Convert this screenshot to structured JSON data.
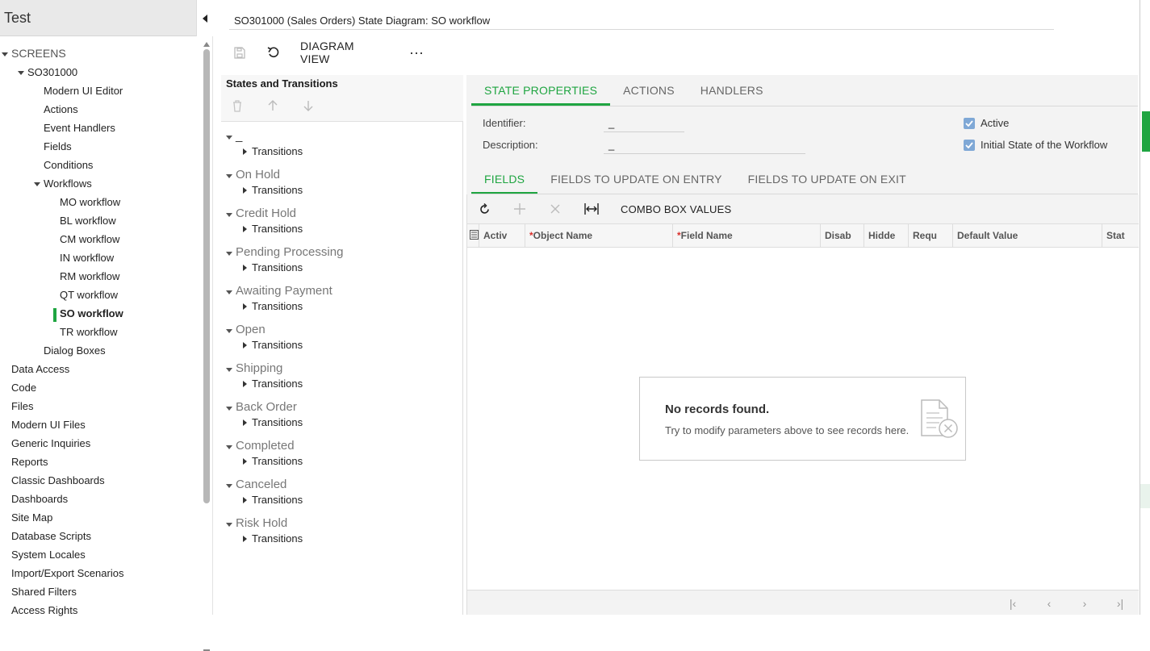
{
  "nav": {
    "title": "Test",
    "tree": [
      {
        "label": "SCREENS",
        "level": 0,
        "expanded": true
      },
      {
        "label": "SO301000",
        "level": 1,
        "expanded": true
      },
      {
        "label": "Modern UI Editor",
        "level": 2
      },
      {
        "label": "Actions",
        "level": 2
      },
      {
        "label": "Event Handlers",
        "level": 2
      },
      {
        "label": "Fields",
        "level": 2
      },
      {
        "label": "Conditions",
        "level": 2
      },
      {
        "label": "Workflows",
        "level": 2,
        "expanded": true
      },
      {
        "label": "MO workflow",
        "level": 3
      },
      {
        "label": "BL workflow",
        "level": 3
      },
      {
        "label": "CM workflow",
        "level": 3
      },
      {
        "label": "IN workflow",
        "level": 3
      },
      {
        "label": "RM workflow",
        "level": 3
      },
      {
        "label": "QT workflow",
        "level": 3
      },
      {
        "label": "SO workflow",
        "level": 3,
        "selected": true
      },
      {
        "label": "TR workflow",
        "level": 3
      },
      {
        "label": "Dialog Boxes",
        "level": 2
      },
      {
        "label": "Data Access",
        "level": 0
      },
      {
        "label": "Code",
        "level": 0
      },
      {
        "label": "Files",
        "level": 0
      },
      {
        "label": "Modern UI Files",
        "level": 0
      },
      {
        "label": "Generic Inquiries",
        "level": 0
      },
      {
        "label": "Reports",
        "level": 0
      },
      {
        "label": "Classic Dashboards",
        "level": 0
      },
      {
        "label": "Dashboards",
        "level": 0
      },
      {
        "label": "Site Map",
        "level": 0
      },
      {
        "label": "Database Scripts",
        "level": 0
      },
      {
        "label": "System Locales",
        "level": 0
      },
      {
        "label": "Import/Export Scenarios",
        "level": 0
      },
      {
        "label": "Shared Filters",
        "level": 0
      },
      {
        "label": "Access Rights",
        "level": 0
      }
    ]
  },
  "page": {
    "title": "SO301000 (Sales Orders) State Diagram: SO workflow",
    "toolbar": {
      "diagram_view": "DIAGRAM VIEW",
      "more": "···"
    }
  },
  "states": {
    "title": "States and Transitions",
    "transitions_label": "Transitions",
    "items": [
      "_",
      "On Hold",
      "Credit Hold",
      "Pending Processing",
      "Awaiting Payment",
      "Open",
      "Shipping",
      "Back Order",
      "Completed",
      "Canceled",
      "Risk Hold"
    ]
  },
  "detail": {
    "tabs": [
      "STATE PROPERTIES",
      "ACTIONS",
      "HANDLERS"
    ],
    "active_tab": 0,
    "identifier_label": "Identifier:",
    "identifier_value": "_",
    "description_label": "Description:",
    "description_value": "_",
    "active_label": "Active",
    "active_checked": true,
    "initial_label": "Initial State of the Workflow",
    "initial_checked": true,
    "subtabs": [
      "FIELDS",
      "FIELDS TO UPDATE ON ENTRY",
      "FIELDS TO UPDATE ON EXIT"
    ],
    "active_subtab": 0,
    "combo_label": "COMBO BOX VALUES",
    "columns": [
      {
        "label": "Activ",
        "required": false
      },
      {
        "label": "Object Name",
        "required": true
      },
      {
        "label": "Field Name",
        "required": true
      },
      {
        "label": "Disab",
        "required": false
      },
      {
        "label": "Hidde",
        "required": false
      },
      {
        "label": "Requ",
        "required": false
      },
      {
        "label": "Default Value",
        "required": false
      },
      {
        "label": "Stat",
        "required": false
      }
    ],
    "empty_title": "No records found.",
    "empty_sub": "Try to modify parameters above to see records here."
  },
  "colors": {
    "accent": "#1fa541",
    "checkbox": "#7fa8d6"
  }
}
